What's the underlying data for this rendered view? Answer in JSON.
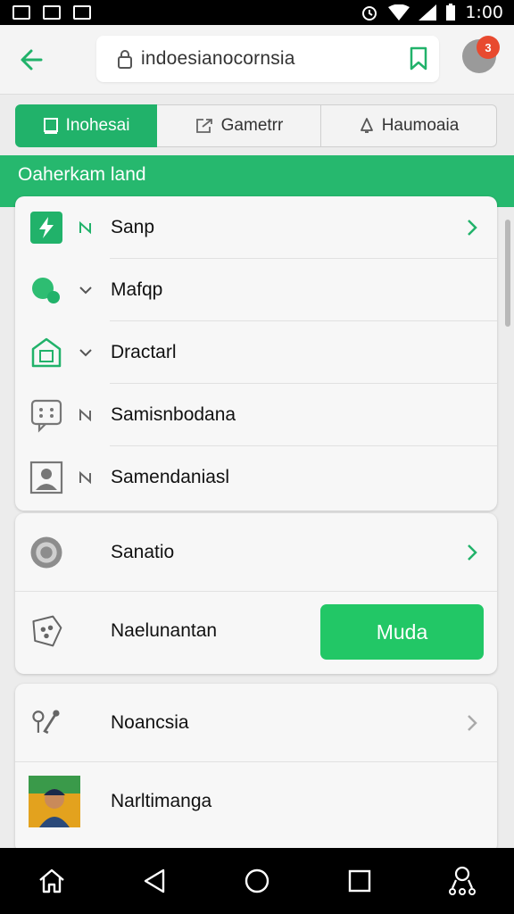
{
  "status_bar": {
    "time": "1:00"
  },
  "header": {
    "url": "indoesianocornsia"
  },
  "notification_badge": "3",
  "tabs": [
    {
      "label": "Inohesai",
      "icon": "tablet-icon",
      "active": true
    },
    {
      "label": "Gametrr",
      "icon": "export-icon",
      "active": false
    },
    {
      "label": "Haumoaia",
      "icon": "bell-icon",
      "active": false
    }
  ],
  "section_title": "Oaherkam land",
  "list": {
    "group1": [
      {
        "label": "Sanp",
        "icon": "lightning-icon"
      },
      {
        "label": "Mafqp",
        "icon": "chat-bubble-icon"
      },
      {
        "label": "Dractarl",
        "icon": "house-icon"
      },
      {
        "label": "Samisnbodana",
        "icon": "message-icon"
      },
      {
        "label": "Samendaniasl",
        "icon": "portrait-icon"
      }
    ],
    "group2": [
      {
        "label": "Sanatio",
        "icon": "target-icon"
      },
      {
        "label": "Naelunantan",
        "icon": "shield-icon",
        "action": "Muda"
      }
    ],
    "group3": [
      {
        "label": "Noancsia",
        "icon": "microphone-icon"
      },
      {
        "label": "Narltimanga",
        "icon": "profile-photo-icon"
      }
    ]
  },
  "colors": {
    "accent": "#21b26a",
    "button": "#22c766",
    "badge": "#e84a2f"
  }
}
